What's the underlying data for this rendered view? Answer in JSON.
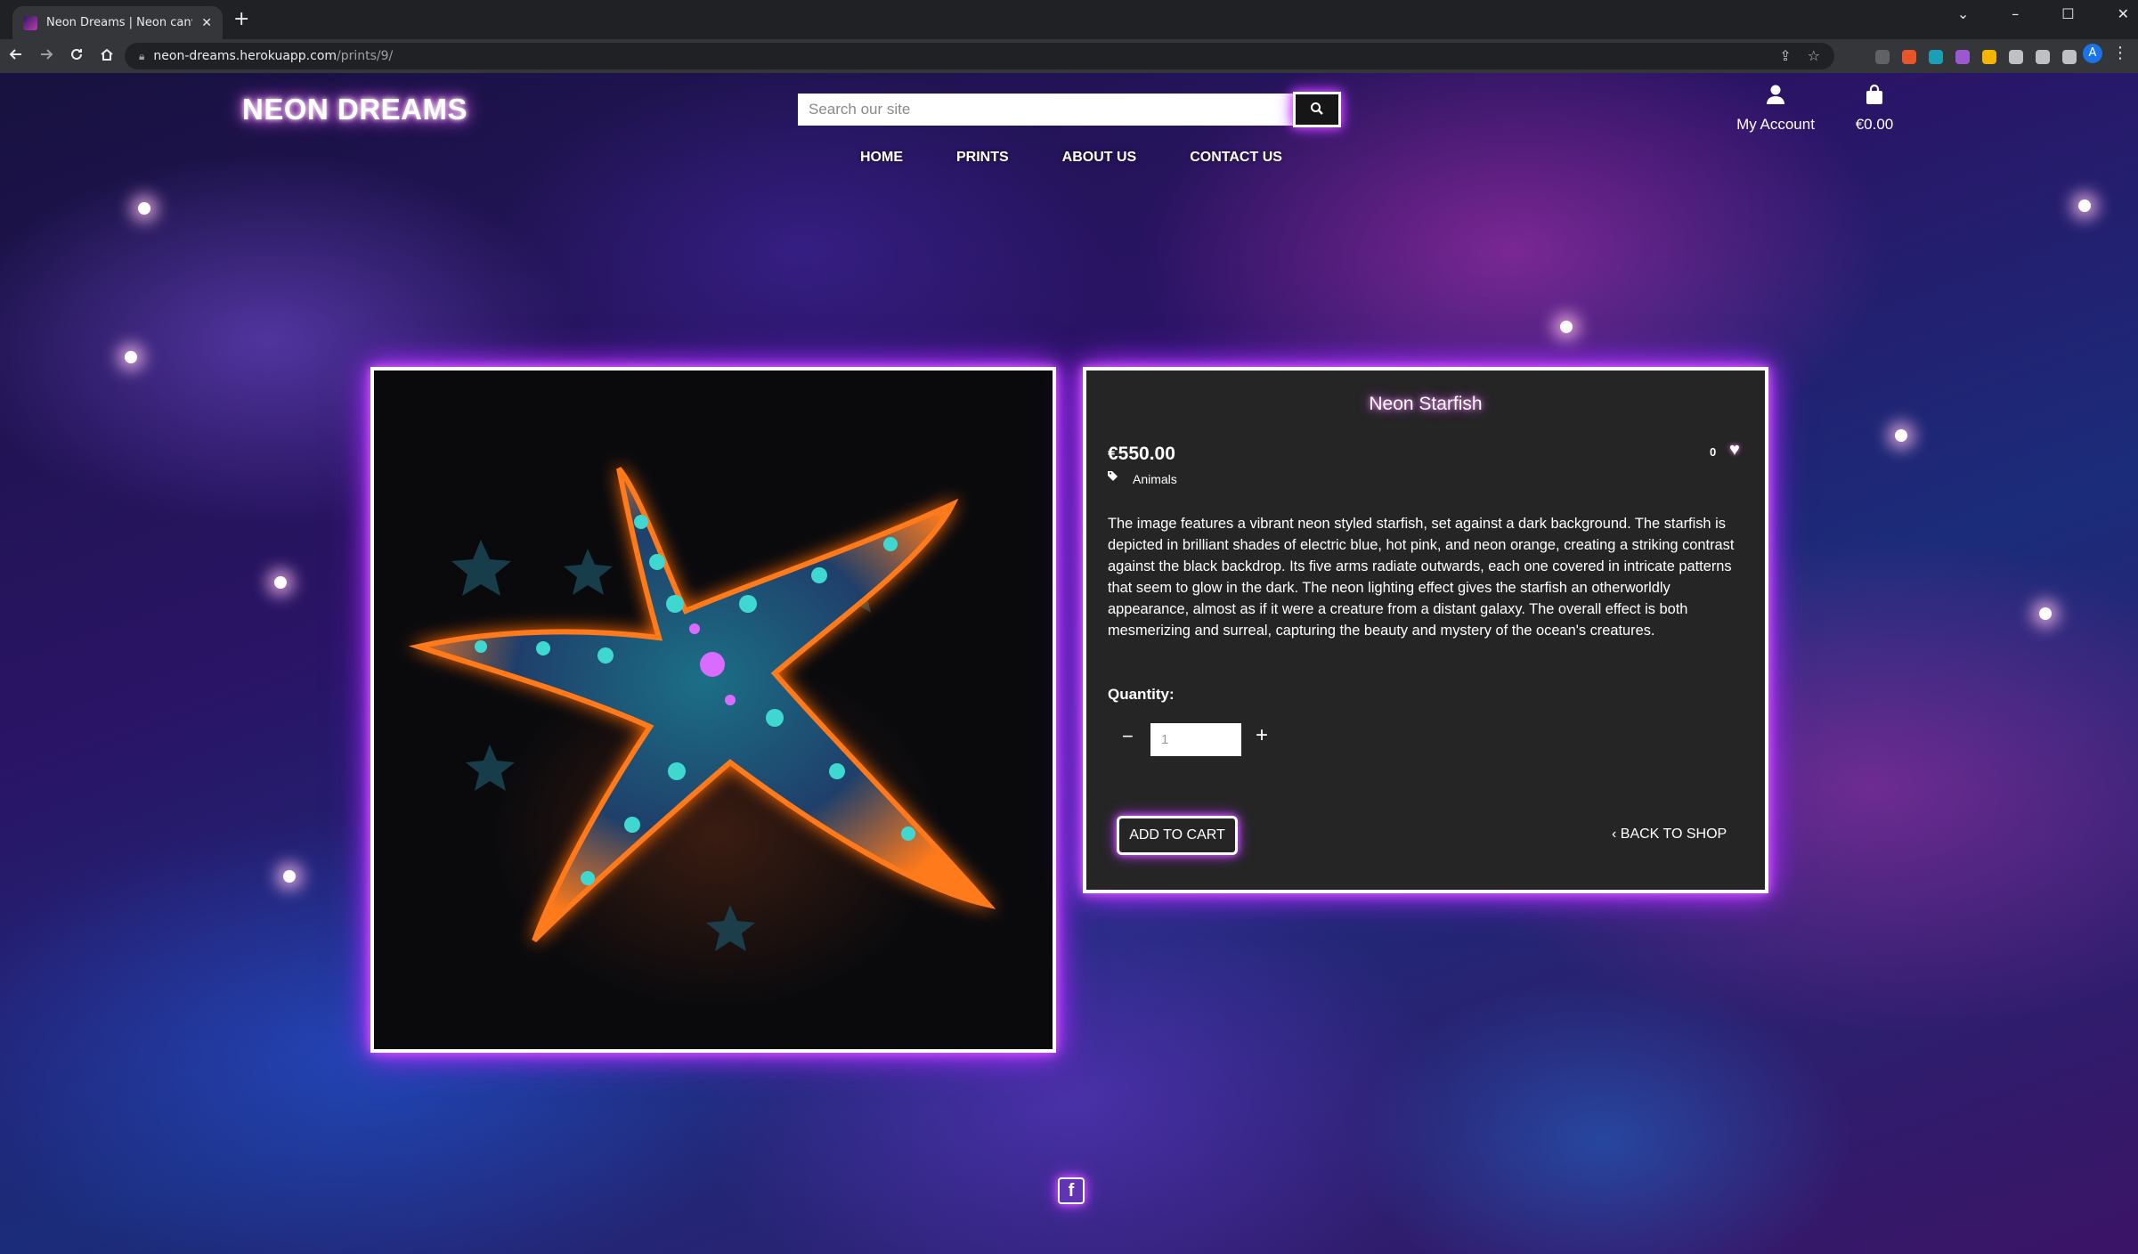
{
  "browser": {
    "tab_title": "Neon Dreams | Neon canvas pri",
    "tab_close": "✕",
    "new_tab": "+",
    "url_host": "neon-dreams.herokuapp.com",
    "url_path": "/prints/9/",
    "win_minimize": "–",
    "win_maximize": "☐",
    "win_close": "✕",
    "win_chevron": "⌄",
    "profile_initial": "A",
    "icons": [
      "back-icon",
      "forward-icon",
      "reload-icon",
      "home-icon",
      "lock-icon",
      "share-icon",
      "bookmark-star-icon",
      "extensions-icon",
      "profile-avatar-icon",
      "menu-kebab-icon"
    ]
  },
  "site": {
    "logo": "NEON DREAMS",
    "search_placeholder": "Search our site",
    "account_label": "My Account",
    "cart_total": "€0.00",
    "nav": [
      "HOME",
      "PRINTS",
      "ABOUT US",
      "CONTACT US"
    ],
    "accent_color": "#c040ff",
    "glow_color": "#e060ff"
  },
  "product": {
    "title": "Neon Starfish",
    "price": "€550.00",
    "favourite_count": "0",
    "category": "Animals",
    "description": "The image features a vibrant neon styled starfish, set against a dark background. The starfish is depicted in brilliant shades of electric blue, hot pink, and neon orange, creating a striking contrast against the black backdrop. Its five arms radiate outwards, each one covered in intricate patterns that seem to glow in the dark. The neon lighting effect gives the starfish an otherworldly appearance, almost as if it were a creature from a distant galaxy. The overall effect is both mesmerizing and surreal, capturing the beauty and mystery of the ocean's creatures.",
    "quantity_label": "Quantity:",
    "quantity_value": "1",
    "add_to_cart": "ADD TO CART",
    "back_to_shop": "BACK TO SHOP"
  },
  "footer": {
    "facebook_icon": "f"
  }
}
